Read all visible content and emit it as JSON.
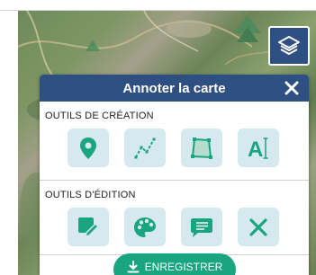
{
  "map": {
    "layers_button_icon": "layers-icon"
  },
  "panel": {
    "title": "Annoter la carte",
    "close_icon": "close-icon",
    "creation_label": "OUTILS DE CRÉATION",
    "creation_tools": [
      {
        "icon": "map-pin-icon"
      },
      {
        "icon": "polyline-icon"
      },
      {
        "icon": "polygon-icon"
      },
      {
        "icon": "text-icon",
        "glyph": "A"
      }
    ],
    "edition_label": "OUTILS D'ÉDITION",
    "edition_tools": [
      {
        "icon": "edit-icon"
      },
      {
        "icon": "palette-icon"
      },
      {
        "icon": "comment-icon"
      },
      {
        "icon": "delete-icon"
      }
    ],
    "save_label": "ENREGISTRER",
    "save_icon": "download-icon"
  },
  "colors": {
    "header": "#2e4f82",
    "tool_icon": "#19a57f",
    "tool_bg": "#d6e9ef",
    "save_button": "#19a57f"
  }
}
